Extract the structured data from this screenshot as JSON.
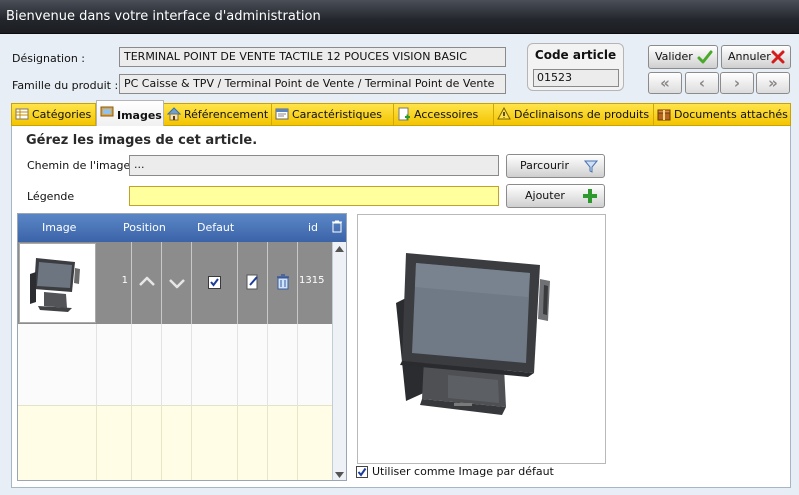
{
  "window": {
    "title": "Bienvenue dans votre interface d'administration"
  },
  "header": {
    "designation_label": "Désignation :",
    "designation_value": "TERMINAL POINT DE VENTE TACTILE 12 POUCES VISION BASIC",
    "famille_label": "Famille du produit :",
    "famille_value": "PC Caisse & TPV / Terminal Point de Vente / Terminal Point de Vente",
    "code_title": "Code article",
    "code_value": "01523"
  },
  "actions": {
    "valider": "Valider",
    "annuler": "Annuler"
  },
  "nav": {
    "first": "«",
    "prev": "‹",
    "next": "›",
    "last": "»"
  },
  "tabs": [
    {
      "label": "Catégories",
      "icon": "grid-icon"
    },
    {
      "label": "Images",
      "icon": "images-icon"
    },
    {
      "label": "Référencement",
      "icon": "house-icon"
    },
    {
      "label": "Caractéristiques",
      "icon": "window-icon"
    },
    {
      "label": "Accessoires",
      "icon": "add-doc-icon"
    },
    {
      "label": "Déclinaisons de produits",
      "icon": "warning-icon"
    },
    {
      "label": "Documents attachés",
      "icon": "package-icon"
    }
  ],
  "images_panel": {
    "title": "Gérez les images de cet article.",
    "path_label": "Chemin de l'image",
    "path_value": "...",
    "legend_label": "Légende",
    "legend_value": "",
    "browse_button": "Parcourir",
    "add_button": "Ajouter"
  },
  "grid": {
    "columns": [
      "Image",
      "Position",
      "Defaut",
      "id"
    ],
    "rows": [
      {
        "position": "1",
        "default": true,
        "id": "1315"
      }
    ]
  },
  "default_checkbox": {
    "label": "Utiliser comme Image par défaut",
    "checked": true
  },
  "colors": {
    "tabbar": "#f3c400",
    "grid_header": "#3b64a8",
    "grid_row_selected": "#8c8c8c",
    "legend_input": "#ffff9e"
  }
}
